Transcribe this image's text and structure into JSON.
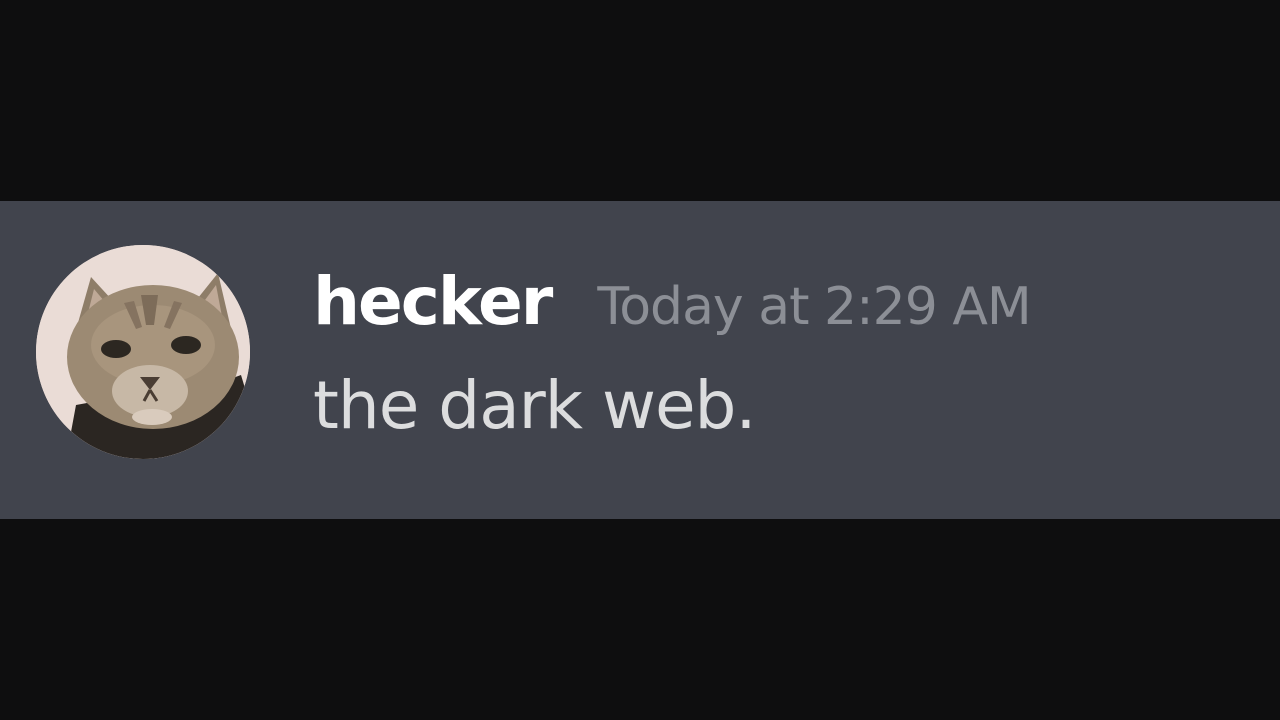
{
  "colors": {
    "background": "#0e0e0f",
    "message_background": "#41444d",
    "username": "#ffffff",
    "timestamp": "#8c8f96",
    "content": "#dcddde"
  },
  "message": {
    "avatar": "cat-avatar",
    "username": "hecker",
    "timestamp": "Today at 2:29 AM",
    "content": "the dark web."
  }
}
